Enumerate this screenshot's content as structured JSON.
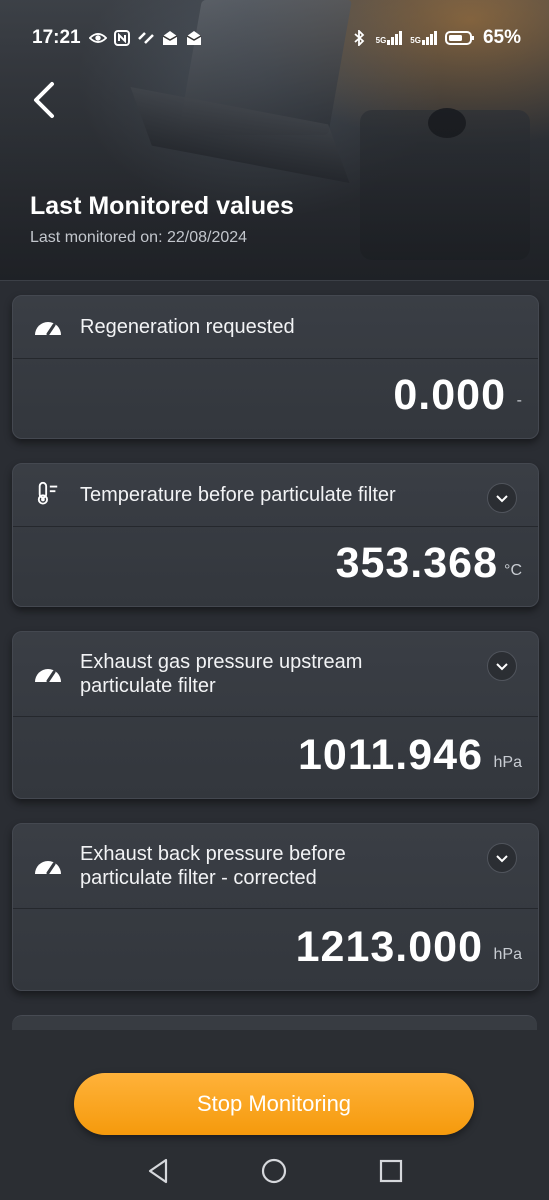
{
  "status_bar": {
    "time": "17:21",
    "battery": "65%",
    "network_1": "5G",
    "network_2": "5G"
  },
  "header": {
    "title": "Last Monitored values",
    "subtitle": "Last monitored on: 22/08/2024"
  },
  "cards": [
    {
      "label": "Regeneration requested",
      "value": "0.000",
      "unit": "-",
      "icon": "gauge-icon"
    },
    {
      "label": "Temperature before particulate filter",
      "value": "353.368",
      "unit": "°C",
      "icon": "thermometer-icon"
    },
    {
      "label_line1": "Exhaust gas pressure upstream",
      "label_line2": "particulate filter",
      "value": "1011.946",
      "unit": "hPa",
      "icon": "gauge-icon"
    },
    {
      "label_line1": "Exhaust back pressure before",
      "label_line2": "particulate filter - corrected",
      "value": "1213.000",
      "unit": "hPa",
      "icon": "gauge-icon"
    }
  ],
  "actions": {
    "stop_label": "Stop Monitoring"
  },
  "colors": {
    "accent": "#f7a31f",
    "card_bg": "#373b41",
    "page_bg": "#2a2d33"
  }
}
